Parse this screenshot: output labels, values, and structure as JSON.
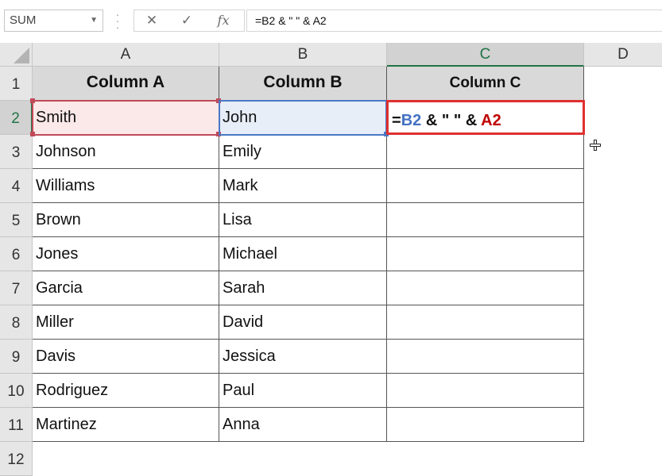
{
  "formula_bar": {
    "name_box": "SUM",
    "cancel_icon": "✕",
    "enter_icon": "✓",
    "fx_label": "fx",
    "formula": "=B2 & \" \" & A2"
  },
  "columns": [
    "A",
    "B",
    "C",
    "D"
  ],
  "rows": [
    "1",
    "2",
    "3",
    "4",
    "5",
    "6",
    "7",
    "8",
    "9",
    "10",
    "11",
    "12"
  ],
  "headers": {
    "a": "Column A",
    "b": "Column B",
    "c": "Column C"
  },
  "data": [
    {
      "a": "Smith",
      "b": "John"
    },
    {
      "a": "Johnson",
      "b": "Emily"
    },
    {
      "a": "Williams",
      "b": "Mark"
    },
    {
      "a": "Brown",
      "b": "Lisa"
    },
    {
      "a": "Jones",
      "b": "Michael"
    },
    {
      "a": "Garcia",
      "b": "Sarah"
    },
    {
      "a": "Miller",
      "b": "David"
    },
    {
      "a": "Davis",
      "b": "Jessica"
    },
    {
      "a": "Rodriguez",
      "b": "Paul"
    },
    {
      "a": "Martinez",
      "b": "Anna"
    }
  ],
  "edit_cell": {
    "eq": "=",
    "ref_b": "B2",
    "mid": " & \" \" & ",
    "ref_a": "A2"
  },
  "colors": {
    "ref_a": "#c04a5a",
    "ref_b": "#4a78c4",
    "selected_header": "#217346",
    "edit_border": "#e03030"
  }
}
